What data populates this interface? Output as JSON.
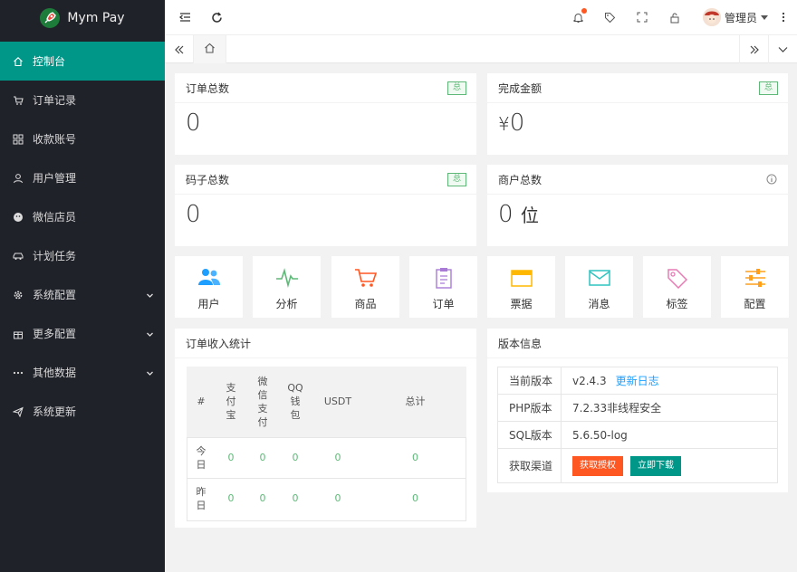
{
  "app": {
    "logo_text": "Mym Pay"
  },
  "sidebar": {
    "items": [
      {
        "label": "控制台",
        "icon": "home-icon",
        "active": true
      },
      {
        "label": "订单记录",
        "icon": "cart-icon"
      },
      {
        "label": "收款账号",
        "icon": "apps-icon"
      },
      {
        "label": "用户管理",
        "icon": "user-icon"
      },
      {
        "label": "微信店员",
        "icon": "wechat-icon"
      },
      {
        "label": "计划任务",
        "icon": "car-icon"
      },
      {
        "label": "系统配置",
        "icon": "gear-icon",
        "expandable": true
      },
      {
        "label": "更多配置",
        "icon": "gift-icon",
        "expandable": true
      },
      {
        "label": "其他数据",
        "icon": "more-icon",
        "expandable": true
      },
      {
        "label": "系统更新",
        "icon": "send-icon"
      }
    ]
  },
  "header": {
    "user_name": "管理员"
  },
  "cards": {
    "orders_total": {
      "title": "订单总数",
      "badge": "总",
      "value": "0"
    },
    "amount_done": {
      "title": "完成金额",
      "badge": "总",
      "currency": "¥",
      "value": "0"
    },
    "codes_total": {
      "title": "码子总数",
      "badge": "总",
      "value": "0"
    },
    "merchants_total": {
      "title": "商户总数",
      "value": "0",
      "unit": "位"
    }
  },
  "shortcuts": [
    {
      "label": "用户",
      "icon": "users-icon",
      "color": "#1e9fff"
    },
    {
      "label": "分析",
      "icon": "chart-pulse-icon",
      "color": "#5fb878"
    },
    {
      "label": "商品",
      "icon": "cart-icon",
      "color": "#ff5722"
    },
    {
      "label": "订单",
      "icon": "clipboard-icon",
      "color": "#a97ad6"
    },
    {
      "label": "票据",
      "icon": "receipt-icon",
      "color": "#ffb800"
    },
    {
      "label": "消息",
      "icon": "mail-icon",
      "color": "#2fc4c0"
    },
    {
      "label": "标签",
      "icon": "tag-icon",
      "color": "#e77bb5"
    },
    {
      "label": "配置",
      "icon": "sliders-icon",
      "color": "#ff9f1a"
    }
  ],
  "income": {
    "title": "订单收入统计",
    "headers": [
      "#",
      "支付宝",
      "微信支付",
      "QQ钱包",
      "USDT",
      "总计"
    ],
    "rows": [
      {
        "label": "今日",
        "values": [
          "0",
          "0",
          "0",
          "0",
          "0"
        ]
      },
      {
        "label": "昨日",
        "values": [
          "0",
          "0",
          "0",
          "0",
          "0"
        ]
      }
    ]
  },
  "version": {
    "title": "版本信息",
    "current_label": "当前版本",
    "current_value": "v2.4.3",
    "changelog_link": "更新日志",
    "php_label": "PHP版本",
    "php_value": "7.2.33非线程安全",
    "sql_label": "SQL版本",
    "sql_value": "5.6.50-log",
    "channel_label": "获取渠道",
    "btn_license": "获取授权",
    "btn_download": "立即下载"
  }
}
